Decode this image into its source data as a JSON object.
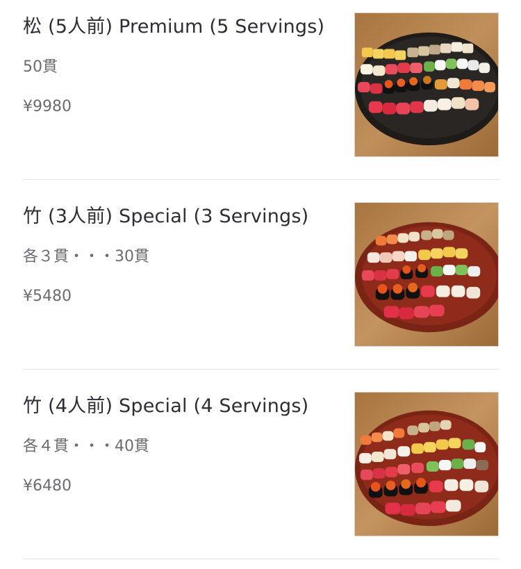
{
  "menu": {
    "items": [
      {
        "name": "松 (5人前) Premium (5 Servings)",
        "description": "50貫",
        "price": "¥9980",
        "plate": "dark",
        "image": "sushi-platter-image"
      },
      {
        "name": "竹 (3人前) Special (3 Servings)",
        "description": "各３貫・・・30貫",
        "price": "¥5480",
        "plate": "red",
        "image": "sushi-platter-image"
      },
      {
        "name": "竹 (4人前) Special (4 Servings)",
        "description": "各４貫・・・40貫",
        "price": "¥6480",
        "plate": "red",
        "image": "sushi-platter-image"
      }
    ]
  },
  "colors": {
    "title": "#2d2d35",
    "secondary_text": "#6b6b70",
    "divider": "#e6e6e6",
    "wood_background": "#b7864f",
    "plate_dark": "#2a2624",
    "plate_red": "#8f2b1b"
  }
}
